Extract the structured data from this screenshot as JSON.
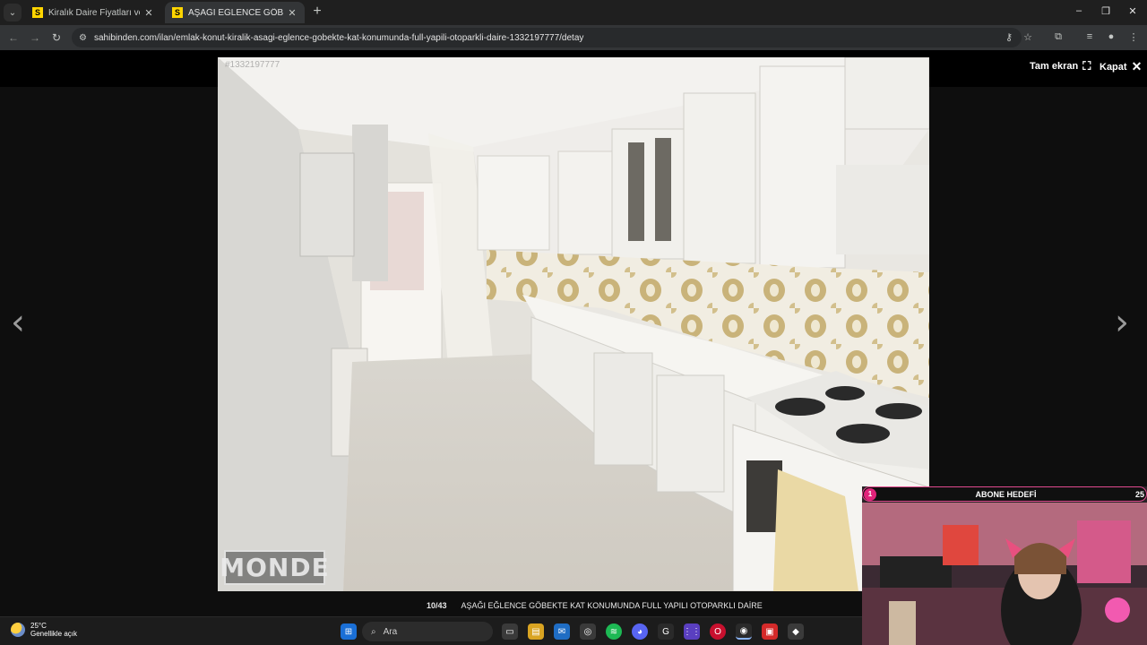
{
  "browser": {
    "tabs": [
      {
        "favicon": "S",
        "title": "Kiralık Daire Fiyatları ve Kiralık Ev"
      },
      {
        "favicon": "S",
        "title": "AŞAĞI EĞLENCE GÖBEKTE KAT"
      }
    ],
    "url": "sahibinden.com/ilan/emlak-konut-kiralik-asagi-eglence-gobekte-kat-konumunda-full-yapili-otoparkli-daire-1332197777/detay",
    "window_controls": {
      "minimize": "–",
      "restore": "❐",
      "close": "✕"
    }
  },
  "gallery": {
    "watermark_id": "#1332197777",
    "logo_text": "MONDE",
    "fullscreen_label": "Tam ekran",
    "close_label": "Kapat",
    "counter": "10/43",
    "caption": "AŞAĞI EĞLENCE GÖBEKTE KAT KONUMUNDA FULL YAPILI OTOPARKLI DAİRE",
    "prev_icon": "‹",
    "next_icon": "›"
  },
  "taskbar": {
    "weather_temp": "25°C",
    "weather_condition": "Genellikle açık",
    "search_placeholder": "Ara"
  },
  "stream_overlay": {
    "goal_badge": "1",
    "goal_title": "ABONE HEDEFİ",
    "goal_target": "25"
  },
  "colors": {
    "accent_pink": "#e0237a",
    "favicon_yellow": "#ffd500"
  }
}
